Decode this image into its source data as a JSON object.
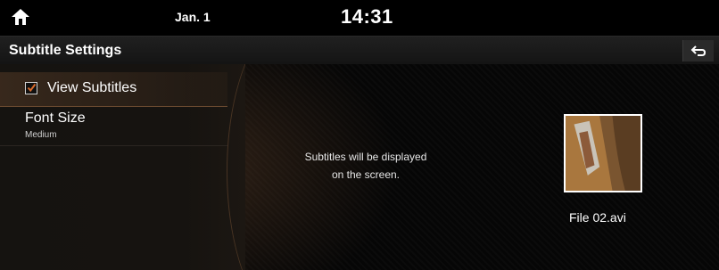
{
  "status": {
    "date": "Jan. 1",
    "time": "14:31",
    "home_icon": "home-icon"
  },
  "header": {
    "title": "Subtitle Settings",
    "back_icon": "back-arrow-icon"
  },
  "menu": {
    "view_subtitles": {
      "label": "View Subtitles",
      "checked": true
    },
    "font_size": {
      "label": "Font Size",
      "value": "Medium"
    }
  },
  "main": {
    "info_line1": "Subtitles will be displayed",
    "info_line2": "on the screen.",
    "file_name": "File 02.avi"
  },
  "colors": {
    "accent": "#d96a2a",
    "background": "#060606",
    "panel": "#151310"
  }
}
